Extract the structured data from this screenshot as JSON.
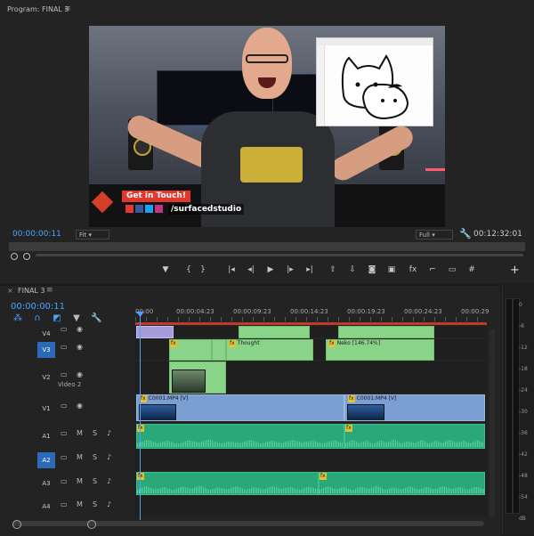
{
  "program": {
    "title": "Program: FINAL 3",
    "menu_glyph": "≡",
    "timecode": "00:00:00:11",
    "fit": "Fit",
    "resolution": "Full",
    "duration": "00:12:32:01",
    "lower_third": {
      "tag": "Get in Touch!",
      "handle": "/surfacedstudio",
      "icon_colors": [
        "#e53935",
        "#3b5998",
        "#1da1f2",
        "#c13584"
      ]
    }
  },
  "transport": {
    "buttons": [
      {
        "name": "marker-icon",
        "glyph": "▼"
      },
      {
        "name": "mark-in-icon",
        "glyph": "{"
      },
      {
        "name": "mark-out-icon",
        "glyph": "}"
      },
      {
        "name": "go-to-in-icon",
        "glyph": "|◂"
      },
      {
        "name": "step-back-icon",
        "glyph": "◂|"
      },
      {
        "name": "play-icon",
        "glyph": "▶"
      },
      {
        "name": "step-forward-icon",
        "glyph": "|▸"
      },
      {
        "name": "go-to-out-icon",
        "glyph": "▸|"
      },
      {
        "name": "lift-icon",
        "glyph": "⇪"
      },
      {
        "name": "extract-icon",
        "glyph": "⇩"
      },
      {
        "name": "export-frame-icon",
        "glyph": "◙"
      },
      {
        "name": "compare-icon",
        "glyph": "▣"
      },
      {
        "name": "fx-icon",
        "glyph": "fx"
      },
      {
        "name": "safe-margins-icon",
        "glyph": "⌐"
      },
      {
        "name": "multicam-icon",
        "glyph": "▭"
      },
      {
        "name": "grid-icon",
        "glyph": "#"
      }
    ],
    "add_glyph": "+"
  },
  "timeline": {
    "close_glyph": "×",
    "title": "FINAL 3",
    "menu_glyph": "≡",
    "timecode": "00:00:00:11",
    "ruler": [
      "00:00",
      "00:00:04:23",
      "00:00:09:23",
      "00:00:14:23",
      "00:00:19:23",
      "00:00:24:23",
      "00:00:29"
    ],
    "tracks": [
      {
        "id": "V4",
        "type": "video",
        "target": false,
        "name": ""
      },
      {
        "id": "V3",
        "type": "video",
        "target": true,
        "name": ""
      },
      {
        "id": "V2",
        "type": "video",
        "target": false,
        "name": "Video 2"
      },
      {
        "id": "V1",
        "type": "video",
        "target": false,
        "name": ""
      },
      {
        "id": "A1",
        "type": "audio",
        "target": false,
        "name": ""
      },
      {
        "id": "A2",
        "type": "audio",
        "target": true,
        "name": ""
      },
      {
        "id": "A3",
        "type": "audio",
        "target": false,
        "name": ""
      },
      {
        "id": "A4",
        "type": "audio",
        "target": false,
        "name": ""
      }
    ],
    "audio_buttons": {
      "mute": "M",
      "solo": "S"
    },
    "clips": {
      "thought": "Thought",
      "neko": "Neko [146.74%]",
      "c0001_a": "C0001.MP4 [V]",
      "c0001_b": "C0001.MP4 [V]",
      "fx": "fx"
    }
  },
  "meters": {
    "labels": [
      "0",
      "-6",
      "-12",
      "-18",
      "-24",
      "-30",
      "-36",
      "-42",
      "-48",
      "-54",
      "dB"
    ]
  },
  "colors": {
    "accent": "#4aa3ff",
    "target": "#2a6ab8",
    "video_clip": "#8ad48a",
    "adjustment_clip": "#a79bd9",
    "main_clip": "#7c9fd3",
    "audio_clip": "#2aa87a",
    "work_area": "#c0392b"
  }
}
